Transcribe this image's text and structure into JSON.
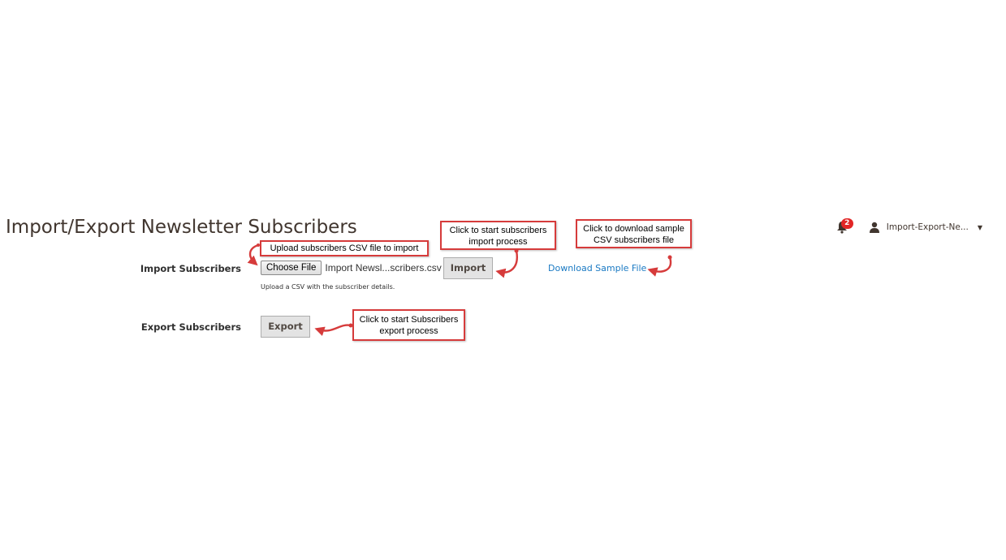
{
  "header": {
    "title": "Import/Export Newsletter Subscribers",
    "notification_count": "2",
    "user_name": "Import-Export-Ne...",
    "caret": "▼"
  },
  "import_section": {
    "label": "Import Subscribers",
    "choose_file_label": "Choose File",
    "selected_file": "Import Newsl...scribers.csv",
    "import_button": "Import",
    "note": "Upload a CSV with the subscriber details.",
    "download_link": "Download Sample File"
  },
  "export_section": {
    "label": "Export Subscribers",
    "export_button": "Export"
  },
  "callouts": {
    "upload": "Upload subscribers CSV file to import",
    "import_line1": "Click to start subscribers",
    "import_line2": "import process",
    "download_line1": "Click to download sample",
    "download_line2": "CSV subscribers file",
    "export_line1": "Click to start Subscribers",
    "export_line2": "export process"
  },
  "colors": {
    "annotation_red": "#d63b3b",
    "link_blue": "#1979c3",
    "badge_red": "#e22626"
  },
  "icons": [
    "bell-icon",
    "user-icon",
    "chevron-down-icon",
    "curved-arrow-icon"
  ]
}
